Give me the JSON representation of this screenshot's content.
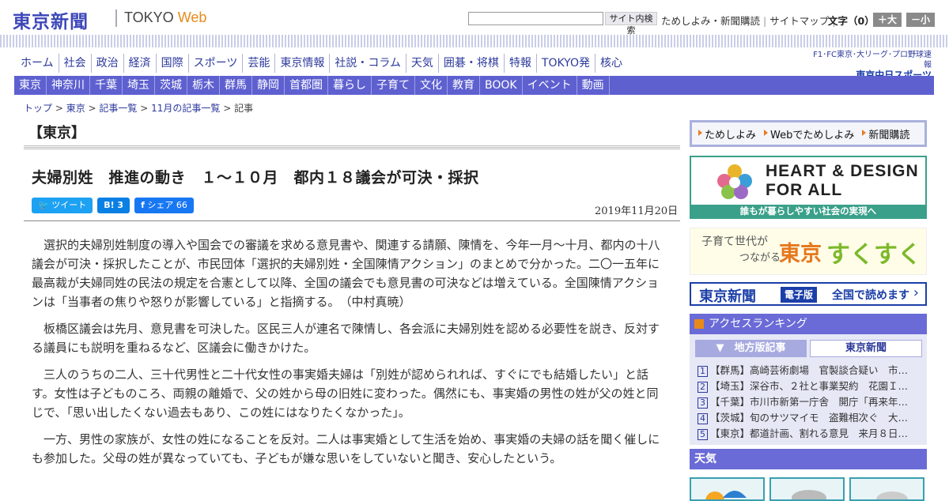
{
  "header": {
    "logo_jp": "東京新聞",
    "logo_en_main": "TOKYO",
    "logo_en_sub": "Web",
    "search_button": "サイト内検索",
    "toplinks": [
      "ためしよみ・新聞購読",
      "サイトマップ"
    ],
    "font_label": "文字（0）",
    "font_plus": "＋大",
    "font_minus": "－小"
  },
  "global_nav": [
    "ホーム",
    "社会",
    "政治",
    "経済",
    "国際",
    "スポーツ",
    "芸能",
    "東京情報",
    "社説・コラム",
    "天気",
    "囲碁・将棋",
    "特報",
    "TOKYO発",
    "核心"
  ],
  "global_nav_right": {
    "line1": "F1･FC東京･大リーグ･プロ野球速報",
    "line2": "東京中日スポーツ"
  },
  "region_nav": [
    "東京",
    "神奈川",
    "千葉",
    "埼玉",
    "茨城",
    "栃木",
    "群馬",
    "静岡",
    "首都圏",
    "暮らし",
    "子育て",
    "文化",
    "教育",
    "BOOK",
    "イベント",
    "動画"
  ],
  "breadcrumb": [
    "トップ",
    "東京",
    "記事一覧",
    "11月の記事一覧",
    "記事"
  ],
  "section_title": "【東京】",
  "article": {
    "headline": "夫婦別姓　推進の動き　１～１０月　都内１８議会が可決・採択",
    "date": "2019年11月20日",
    "social": {
      "tweet": "ツイート",
      "hatena": "B! 3",
      "share": "シェア 66"
    },
    "paragraphs": [
      "選択的夫婦別姓制度の導入や国会での審議を求める意見書や、関連する請願、陳情を、今年一月～十月、都内の十八議会が可決・採択したことが、市民団体「選択的夫婦別姓・全国陳情アクション」のまとめで分かった。二〇一五年に最高裁が夫婦同姓の民法の規定を合憲として以降、全国の議会でも意見書の可決などは増えている。全国陳情アクションは「当事者の焦りや怒りが影響している」と指摘する。　（中村真暁）",
      "板橋区議会は先月、意見書を可決した。区民三人が連名で陳情し、各会派に夫婦別姓を認める必要性を説き、反対する議員にも説明を重ねるなど、区議会に働きかけた。",
      "三人のうちの二人、三十代男性と二十代女性の事実婚夫婦は「別姓が認められれば、すぐにでも結婚したい」と話す。女性は子どものころ、両親の離婚で、父の姓から母の旧姓に変わった。偶然にも、事実婚の男性の姓が父の姓と同じで、「思い出したくない過去もあり、この姓にはなりたくなかった」。",
      "一方、男性の家族が、女性の姓になることを反対。二人は事実婚として生活を始め、事実婚の夫婦の話を聞く催しにも参加した。父母の姓が異なっていても、子どもが嫌な思いをしていないと聞き、安心したという。"
    ]
  },
  "sidebar": {
    "tameshi": [
      "ためしよみ",
      "Webでためしよみ",
      "新聞購読"
    ],
    "heart_title_1": "HEART & DESIGN",
    "heart_title_2": "FOR ALL",
    "heart_caption": "誰もが暮らしやすい社会の実現へ",
    "suku_1": "子育て世代が",
    "suku_2": "つながる",
    "suku_3": "東京",
    "suku_4": "すくすく",
    "digital_1": "東京新聞",
    "digital_2": "電子版",
    "digital_3": "全国で読めます",
    "ranking_title": "アクセスランキング",
    "ranking_tabs": [
      "地方版記事",
      "東京新聞"
    ],
    "ranking": [
      {
        "n": "1",
        "text": "【群馬】高崎芸術劇場　官製談合疑い　市…"
      },
      {
        "n": "2",
        "text": "【埼玉】深谷市、２社と事業契約　花園Ｉ…"
      },
      {
        "n": "3",
        "text": "【千葉】市川市新第一庁舎　開庁「再来年…"
      },
      {
        "n": "4",
        "text": "【茨城】旬のサツマイモ　盗難相次ぐ　大…"
      },
      {
        "n": "5",
        "text": "【東京】都道計画、割れる意見　来月８日…"
      }
    ],
    "weather_title": "天気"
  }
}
